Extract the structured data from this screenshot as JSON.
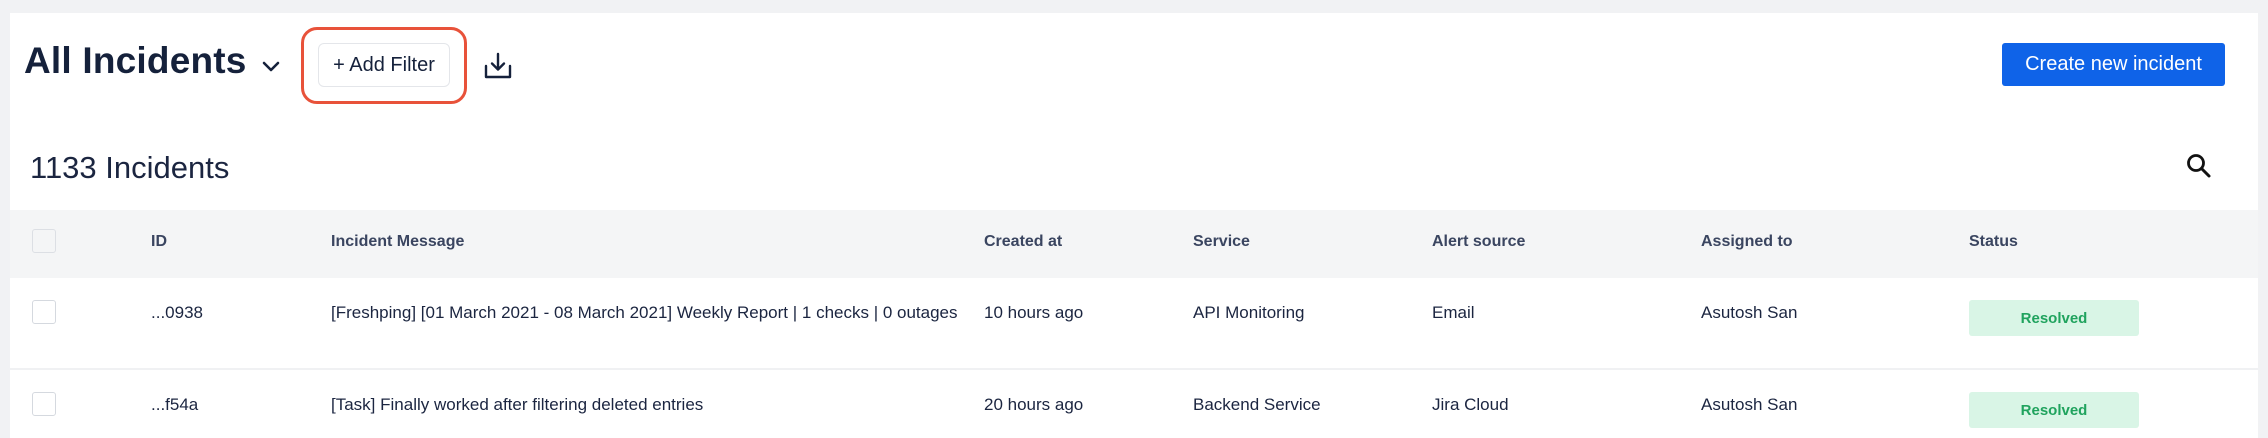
{
  "header": {
    "title": "All Incidents",
    "add_filter_label": "+ Add Filter",
    "create_button_label": "Create new incident",
    "icons": {
      "title_caret": "chevron-down-icon",
      "download": "download-icon",
      "search": "search-icon"
    }
  },
  "summary": {
    "count_label": "1133 Incidents"
  },
  "table": {
    "columns": [
      "ID",
      "Incident Message",
      "Created at",
      "Service",
      "Alert source",
      "Assigned to",
      "Status"
    ],
    "rows": [
      {
        "id": "...0938",
        "message": "[Freshping] [01 March 2021 - 08 March 2021] Weekly Report | 1 checks | 0 outages",
        "created_at": "10 hours ago",
        "service": "API Monitoring",
        "alert_source": "Email",
        "assigned_to": "Asutosh San",
        "status": "Resolved"
      },
      {
        "id": "...f54a",
        "message": "[Task] Finally worked after filtering deleted entries",
        "created_at": "20 hours ago",
        "service": "Backend Service",
        "alert_source": "Jira Cloud",
        "assigned_to": "Asutosh San",
        "status": "Resolved"
      }
    ]
  },
  "colors": {
    "primary_button": "#0f63e8",
    "highlight_outline": "#e8523a",
    "status_resolved_bg": "#d9f5e6",
    "status_resolved_text": "#20a35e"
  }
}
